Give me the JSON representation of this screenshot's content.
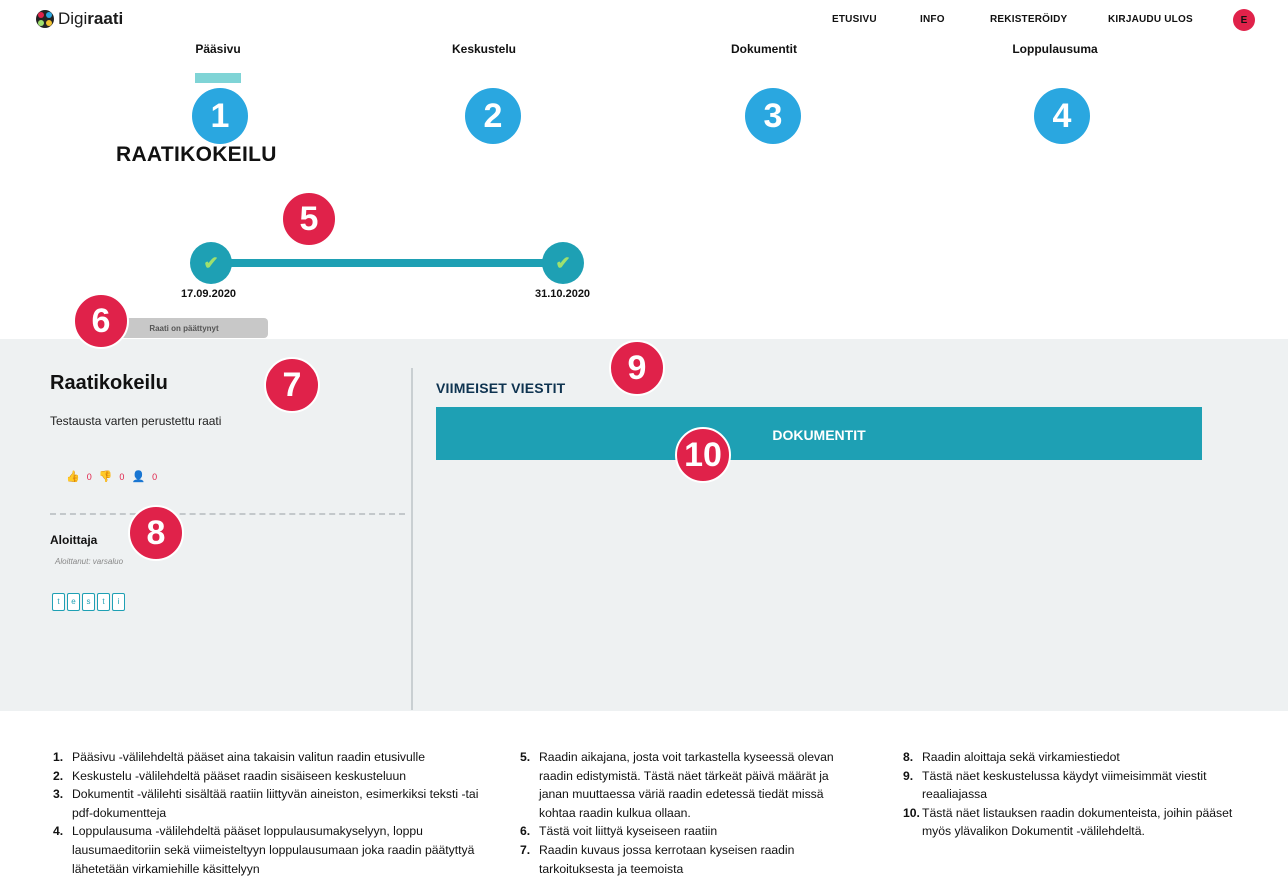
{
  "app": {
    "logo_prefix": "Digi",
    "logo_suffix": "raati"
  },
  "nav": {
    "etusivu": "ETUSIVU",
    "info": "INFO",
    "rekisteroidy": "REKISTERÖIDY",
    "kirjaudu_ulos": "KIRJAUDU ULOS",
    "avatar_letter": "E"
  },
  "tabs": [
    {
      "label": "Pääsivu",
      "number": "1"
    },
    {
      "label": "Keskustelu",
      "number": "2"
    },
    {
      "label": "Dokumentit",
      "number": "3"
    },
    {
      "label": "Loppulausuma",
      "number": "4"
    }
  ],
  "page_title": "RAATIKOKEILU",
  "timeline": {
    "start_date": "17.09.2020",
    "end_date": "31.10.2020",
    "status": "Raati on päättynyt"
  },
  "markers": [
    "5",
    "6",
    "7",
    "8",
    "9",
    "10"
  ],
  "raati": {
    "name": "Raatikokeilu",
    "description": "Testausta varten perustettu raati",
    "likes": "0",
    "dislikes": "0",
    "participants": "0",
    "aloittaja_heading": "Aloittaja",
    "aloittanut": "Aloittanut: varsaluo",
    "tags": [
      "t",
      "e",
      "s",
      "t",
      "i"
    ]
  },
  "messages": {
    "heading": "VIIMEISET VIESTIT",
    "documents_button": "DOKUMENTIT"
  },
  "legend": [
    {
      "n": "1.",
      "text": "Pääsivu -välilehdeltä pääset aina takaisin valitun raadin etusivulle"
    },
    {
      "n": "2.",
      "text": "Keskustelu -välilehdeltä pääset raadin sisäiseen keskusteluun"
    },
    {
      "n": "3.",
      "text": "Dokumentit -välilehti sisältää raatiin liittyvän aineiston, esimerkiksi teksti -tai pdf-dokumentteja"
    },
    {
      "n": "4.",
      "text": "Loppulausuma -välilehdeltä pääset loppulausumakyselyyn, loppu lausumaeditoriin sekä viimeisteltyyn loppulausumaan joka raadin päätyttyä lähetetään virkamiehille käsittelyyn"
    },
    {
      "n": "5.",
      "text": "Raadin aikajana, josta voit tarkastella kyseessä olevan raadin edistymistä. Tästä näet tärkeät päivä määrät ja janan muuttaessa väriä raadin edetessä tiedät missä kohtaa raadin kulkua ollaan."
    },
    {
      "n": "6.",
      "text": "Tästä voit liittyä kyseiseen raatiin"
    },
    {
      "n": "7.",
      "text": "Raadin kuvaus jossa kerrotaan kyseisen raadin tarkoituksesta ja teemoista"
    },
    {
      "n": "8.",
      "text": "Raadin aloittaja sekä virkamiestiedot"
    },
    {
      "n": "9.",
      "text": "Tästä näet keskustelussa käydyt viimeisimmät viestit reaaliajassa"
    },
    {
      "n": "10.",
      "text": "Tästä näet listauksen raadin dokumenteista, joihin pääset myös ylävalikon Dokumentit -välilehdeltä."
    }
  ],
  "colors": {
    "accent_teal": "#1ea0b4",
    "tab_blue": "#2aa7e0",
    "marker_red": "#e0224a",
    "grey_bg": "#eef1f2",
    "heading_navy": "#0e3350"
  },
  "icons": {
    "like": "thumbs-up-icon",
    "dislike": "thumbs-down-icon",
    "participants": "user-icon",
    "timeline_node": "check-icon"
  }
}
